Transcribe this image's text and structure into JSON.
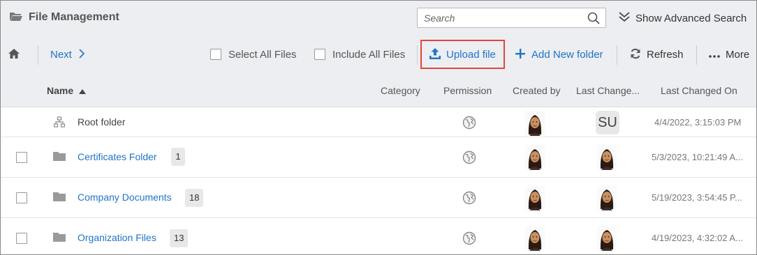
{
  "header": {
    "title": "File Management",
    "search_placeholder": "Search",
    "advanced_search_label": "Show Advanced Search"
  },
  "toolbar": {
    "next_label": "Next",
    "select_all_label": "Select All Files",
    "include_all_label": "Include All Files",
    "upload_label": "Upload file",
    "add_folder_label": "Add New folder",
    "refresh_label": "Refresh",
    "more_label": "More"
  },
  "columns": {
    "name": "Name",
    "category": "Category",
    "permission": "Permission",
    "created_by": "Created by",
    "last_changed_by": "Last Change...",
    "last_changed_on": "Last Changed On"
  },
  "rows": [
    {
      "name": "Root folder",
      "count": "",
      "changed_by_initials": "SU",
      "date": "4/4/2022, 3:15:03 PM"
    },
    {
      "name": "Certificates Folder",
      "count": "1",
      "changed_by_initials": "",
      "date": "5/3/2023, 10:21:49 A..."
    },
    {
      "name": "Company Documents",
      "count": "18",
      "changed_by_initials": "",
      "date": "5/19/2023, 3:54:45 P..."
    },
    {
      "name": "Organization Files",
      "count": "13",
      "changed_by_initials": "",
      "date": "4/19/2023, 4:32:02 A..."
    }
  ],
  "colors": {
    "accent": "#1f74c8",
    "highlight_box": "#e0463c",
    "toolbar_bg": "#eceef1"
  },
  "icons": {
    "title": "folder-open-icon",
    "search": "search-icon",
    "advanced": "chevron-double-down-icon",
    "home": "home-icon",
    "next": "chevron-right-icon",
    "upload": "upload-icon",
    "add": "plus-icon",
    "refresh": "refresh-icon",
    "more": "ellipsis-icon",
    "sort": "sort-asc-icon",
    "root": "sitemap-icon",
    "folder": "folder-icon",
    "permission": "globe-icon"
  }
}
